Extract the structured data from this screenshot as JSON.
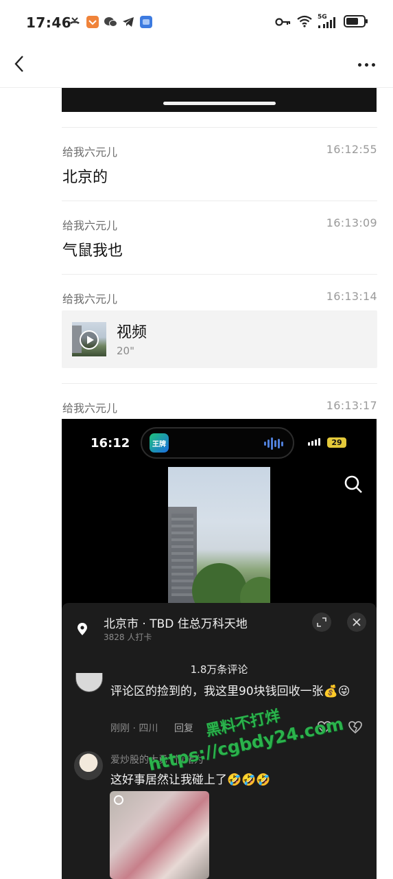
{
  "status_bar": {
    "time": "17:46",
    "left_icons": [
      "missed-call-icon",
      "app-badge-icon",
      "wechat-icon",
      "telegram-icon",
      "blue-app-icon"
    ],
    "right_icons": [
      "key-icon",
      "wifi-icon",
      "signal-5g-icon",
      "battery-icon"
    ],
    "network": "5G"
  },
  "nav": {
    "back_icon": "chevron-left-icon",
    "more_icon": "more-dots-icon"
  },
  "messages": [
    {
      "sender": "给我六元儿",
      "time": "16:12:55",
      "text": "北京的"
    },
    {
      "sender": "给我六元儿",
      "time": "16:13:09",
      "text": "气鼠我也"
    },
    {
      "sender": "给我六元儿",
      "time": "16:13:14",
      "video": {
        "title": "视频",
        "duration": "20\""
      }
    },
    {
      "sender": "给我六元儿",
      "time": "16:13:17"
    }
  ],
  "screenshot": {
    "time": "16:12",
    "app_label": "王牌",
    "battery": "29",
    "location_name": "北京市 · TBD 住总万科天地",
    "checkins": "3828 人打卡",
    "comment_count": "1.8万条评论",
    "comment1": {
      "text": "评论区的捡到的，我这里90块钱回收一张💰😜",
      "meta": "刚刚 · 四川",
      "reply": "回复"
    },
    "comment2": {
      "name": "爱炒股的大勇 (情绪为",
      "text": "这好事居然让我碰上了🤣🤣🤣"
    }
  },
  "watermark": {
    "line1": "黑料不打烊",
    "line2": "https://cgbdy24.com"
  },
  "colors": {
    "watermark": "#2bb24c",
    "panel": "#1c1c1c",
    "card": "#f3f3f3"
  }
}
